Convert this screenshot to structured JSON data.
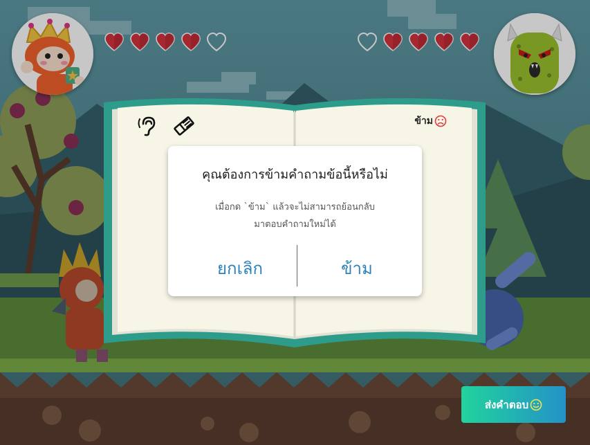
{
  "player": {
    "icon": "king-robot-avatar",
    "hearts_filled": 4,
    "hearts_total": 5
  },
  "enemy": {
    "icon": "green-monster-avatar",
    "hearts_filled": 4,
    "hearts_total": 5
  },
  "book": {
    "tools": [
      "ear-icon",
      "eraser-icon"
    ],
    "skip_label": "ข้าม",
    "skip_icon": "sad-face-icon"
  },
  "dialog": {
    "title": "คุณต้องการข้ามคำถามข้อนี้หรือไม่",
    "message_line1": "เมื่อกด `ข้าม` แล้วจะไม่สามารถย้อนกลับ",
    "message_line2": "มาตอบคำถามใหม่ได้",
    "cancel_label": "ยกเลิก",
    "confirm_label": "ข้าม"
  },
  "submit": {
    "label": "ส่งคำตอบ",
    "icon": "smile-icon"
  },
  "colors": {
    "heart": "#d4323e",
    "book_cover": "#2e9c8b",
    "page": "#f7f5e6",
    "button_blue": "#2e82b8"
  }
}
